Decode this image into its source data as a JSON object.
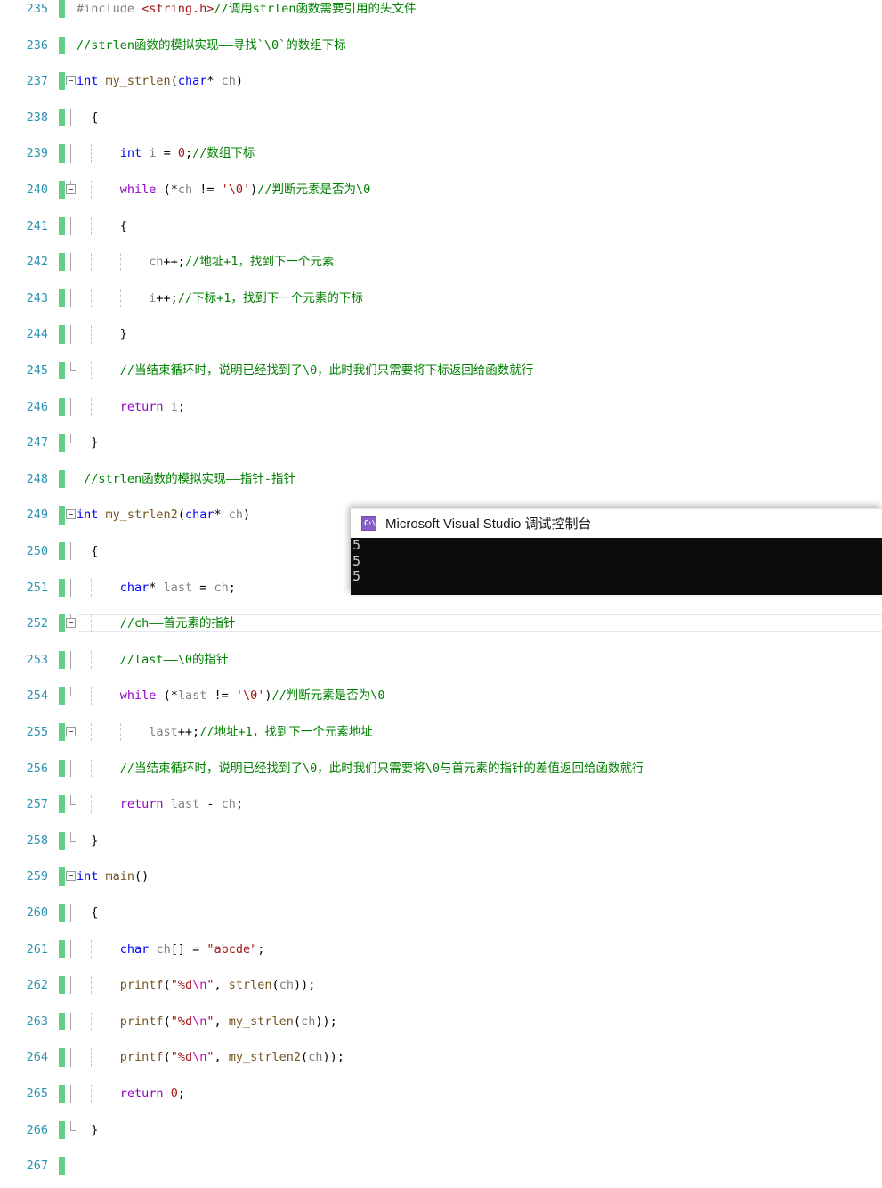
{
  "editor": {
    "first_line_number": 235,
    "current_line_number": 252,
    "lines": [
      {
        "num": "235",
        "text": "  #include <string.h>//调用strlen函数需要引用的头文件"
      },
      {
        "num": "236",
        "text": "  //strlen函数的模拟实现——寻找`\\0`的数组下标"
      },
      {
        "num": "237",
        "text": "int my_strlen(char* ch)"
      },
      {
        "num": "238",
        "text": "  {"
      },
      {
        "num": "239",
        "text": "      int i = 0;//数组下标"
      },
      {
        "num": "240",
        "text": "      while (*ch != '\\0')//判断元素是否为\\0"
      },
      {
        "num": "241",
        "text": "      {"
      },
      {
        "num": "242",
        "text": "          ch++;//地址+1，找到下一个元素"
      },
      {
        "num": "243",
        "text": "          i++;//下标+1，找到下一个元素的下标"
      },
      {
        "num": "244",
        "text": "      }"
      },
      {
        "num": "245",
        "text": "      //当结束循环时，说明已经找到了\\0，此时我们只需要将下标返回给函数就行"
      },
      {
        "num": "246",
        "text": "      return i;"
      },
      {
        "num": "247",
        "text": "  }"
      },
      {
        "num": "248",
        "text": "  //strlen函数的模拟实现——指针-指针"
      },
      {
        "num": "249",
        "text": "int my_strlen2(char* ch)"
      },
      {
        "num": "250",
        "text": "  {"
      },
      {
        "num": "251",
        "text": "      char* last = ch;"
      },
      {
        "num": "252",
        "text": "      //ch——首元素的指针"
      },
      {
        "num": "253",
        "text": "      //last——\\0的指针"
      },
      {
        "num": "254",
        "text": "      while (*last != '\\0')//判断元素是否为\\0"
      },
      {
        "num": "255",
        "text": "          last++;//地址+1，找到下一个元素地址"
      },
      {
        "num": "256",
        "text": "      //当结束循环时，说明已经找到了\\0，此时我们只需要将\\0与首元素的指针的差值返回给函数就行"
      },
      {
        "num": "257",
        "text": "      return last - ch;"
      },
      {
        "num": "258",
        "text": "  }"
      },
      {
        "num": "259",
        "text": "int main()"
      },
      {
        "num": "260",
        "text": "  {"
      },
      {
        "num": "261",
        "text": "      char ch[] = \"abcde\";"
      },
      {
        "num": "262",
        "text": "      printf(\"%d\\n\", strlen(ch));"
      },
      {
        "num": "263",
        "text": "      printf(\"%d\\n\", my_strlen(ch));"
      },
      {
        "num": "264",
        "text": "      printf(\"%d\\n\", my_strlen2(ch));"
      },
      {
        "num": "265",
        "text": "      return 0;"
      },
      {
        "num": "266",
        "text": "  }"
      },
      {
        "num": "267",
        "text": ""
      }
    ],
    "colors": {
      "line_number": "#2b91af",
      "keyword": "#0000ff",
      "control_keyword": "#8f08c4",
      "comment": "#008000",
      "string": "#a31515",
      "function": "#74531f",
      "variable": "#808080",
      "change_bar": "#62d186",
      "background": "#ffffff"
    }
  },
  "console": {
    "title": "Microsoft Visual Studio 调试控制台",
    "icon_label": "C:\\",
    "output_lines": [
      "5",
      "5",
      "5"
    ],
    "colors": {
      "background": "#0c0c0c",
      "text": "#cccccc",
      "icon": "#8661c5"
    }
  }
}
